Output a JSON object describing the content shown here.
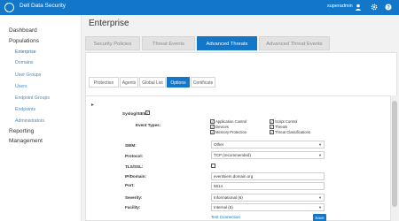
{
  "app": {
    "title": "Dell Data Security",
    "username": "superadmin"
  },
  "sidebar": {
    "items": [
      {
        "label": "Dashboard"
      },
      {
        "label": "Populations"
      },
      {
        "label": "Enterprise"
      },
      {
        "label": "Domains"
      },
      {
        "label": "User Groups"
      },
      {
        "label": "Users"
      },
      {
        "label": "Endpoint Groups"
      },
      {
        "label": "Endpoints"
      },
      {
        "label": "Administrators"
      },
      {
        "label": "Reporting"
      },
      {
        "label": "Management"
      }
    ]
  },
  "main": {
    "title": "Enterprise",
    "tabs": [
      {
        "label": "Security Policies"
      },
      {
        "label": "Threat Events"
      },
      {
        "label": "Advanced Threats"
      },
      {
        "label": "Advanced Threat Events"
      }
    ],
    "subtabs": [
      {
        "label": "Protection"
      },
      {
        "label": "Agents"
      },
      {
        "label": "Global List"
      },
      {
        "label": "Options"
      },
      {
        "label": "Certificate"
      }
    ]
  },
  "form": {
    "syslog_label": "Syslog/SIEM:",
    "syslog_checked": "✓",
    "event_types_label": "Event Types:",
    "event_types": [
      {
        "label": "Application Control",
        "checked": "✓"
      },
      {
        "label": "Script Control",
        "checked": "✓"
      },
      {
        "label": "Devices",
        "checked": "✓"
      },
      {
        "label": "Threats",
        "checked": "✓"
      },
      {
        "label": "Memory Protection",
        "checked": "✓"
      },
      {
        "label": "Threat Classifications",
        "checked": "✓"
      }
    ],
    "siem_label": "SIEM:",
    "siem_value": "Other",
    "protocol_label": "Protocol:",
    "protocol_value": "TCP (recommended)",
    "tls_label": "TLS/SSL:",
    "ip_label": "IP/Domain:",
    "ip_value": "eventsiem.domain.org",
    "port_label": "Port:",
    "port_value": "5514",
    "severity_label": "Severity:",
    "severity_value": "Informational (6)",
    "facility_label": "Facility:",
    "facility_value": "Internal (5)",
    "test_connection": "Test Connection",
    "save": "Save"
  },
  "colors": {
    "accent": "#1277c9"
  }
}
